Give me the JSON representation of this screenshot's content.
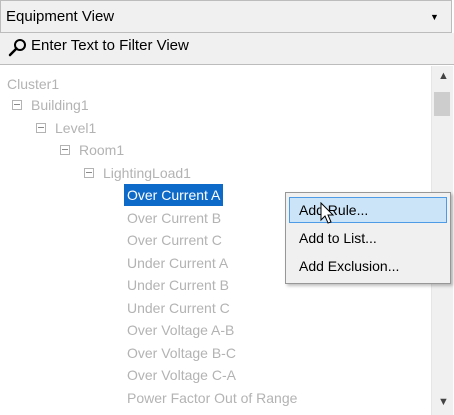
{
  "view_selector": {
    "value": "Equipment View",
    "arrow_icon": "dropdown-arrow-icon"
  },
  "filter": {
    "placeholder": "Enter Text to Filter View",
    "icon": "magnifier-icon"
  },
  "tree": {
    "cluster": "Cluster1",
    "building": "Building1",
    "level": "Level1",
    "room": "Room1",
    "load": "LightingLoad1",
    "rules": [
      "Over Current A",
      "Over Current B",
      "Over Current C",
      "Under Current A",
      "Under Current B",
      "Under Current C",
      "Over Voltage A-B",
      "Over Voltage B-C",
      "Over Voltage C-A",
      "Power Factor Out of Range"
    ],
    "selected_index": 0
  },
  "context_menu": {
    "items": [
      "Add Rule...",
      "Add to List...",
      "Add Exclusion..."
    ],
    "hovered_index": 0
  },
  "colors": {
    "selection": "#0e6ac9",
    "disabled_text": "#b3b3b3",
    "menu_hover": "#cce4f7"
  }
}
